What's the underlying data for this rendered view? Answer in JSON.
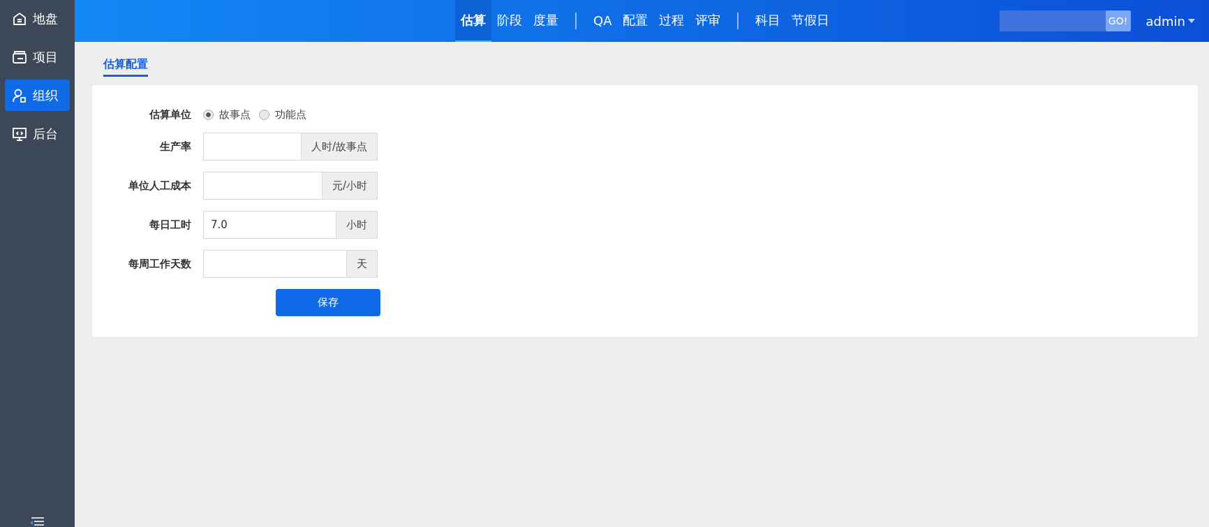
{
  "sidebar": {
    "items": [
      {
        "label": "地盘",
        "selected": false
      },
      {
        "label": "项目",
        "selected": false
      },
      {
        "label": "组织",
        "selected": true
      },
      {
        "label": "后台",
        "selected": false
      }
    ]
  },
  "nav": {
    "groups": [
      [
        {
          "label": "估算",
          "selected": true
        },
        {
          "label": "阶段",
          "selected": false
        },
        {
          "label": "度量",
          "selected": false
        }
      ],
      [
        {
          "label": "QA",
          "selected": false
        },
        {
          "label": "配置",
          "selected": false
        },
        {
          "label": "过程",
          "selected": false
        },
        {
          "label": "评审",
          "selected": false
        }
      ],
      [
        {
          "label": "科目",
          "selected": false
        },
        {
          "label": "节假日",
          "selected": false
        }
      ]
    ]
  },
  "search": {
    "button": "GO!"
  },
  "user": {
    "name": "admin"
  },
  "tabs": [
    {
      "label": "估算配置",
      "selected": true
    }
  ],
  "form": {
    "rows": [
      {
        "kind": "radio",
        "label": "估算单位",
        "options": [
          {
            "label": "故事点",
            "selected": true
          },
          {
            "label": "功能点",
            "selected": false
          }
        ]
      },
      {
        "kind": "input",
        "label": "生产率",
        "addon": "人时/故事点"
      },
      {
        "kind": "input",
        "label": "单位人工成本",
        "addon": "元/小时"
      },
      {
        "kind": "input",
        "label": "每日工时",
        "value": "7.0",
        "addon": "小时"
      },
      {
        "kind": "input",
        "label": "每周工作天数",
        "addon": "天"
      }
    ],
    "save": "保存"
  }
}
